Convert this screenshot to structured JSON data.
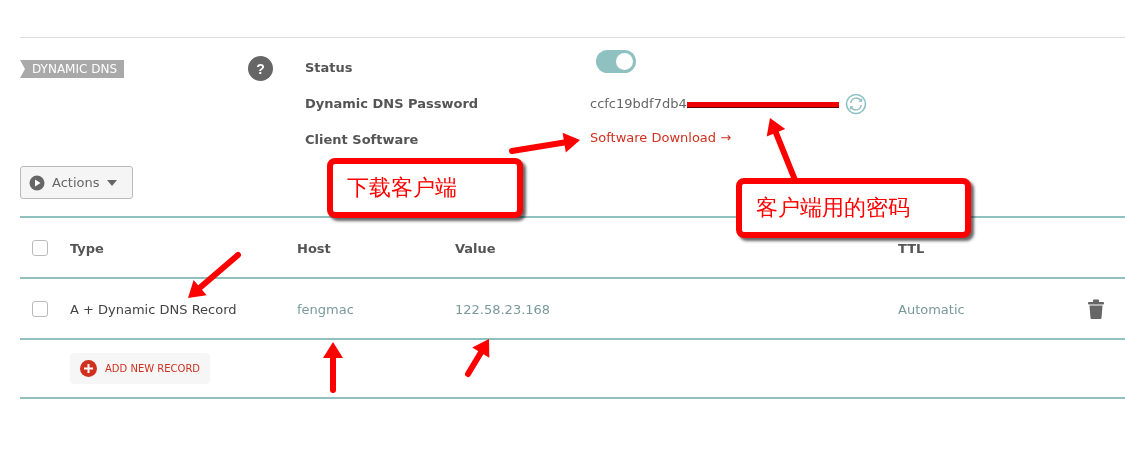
{
  "section": {
    "tag": "DYNAMIC DNS",
    "help": "?",
    "fields": [
      {
        "kind": "toggle",
        "label": "Status",
        "on": true
      },
      {
        "kind": "password",
        "label": "Dynamic DNS Password",
        "value": "ccfc19bdf7db4"
      },
      {
        "kind": "link",
        "label": "Client Software",
        "value": "Software Download →"
      }
    ]
  },
  "actions_button": {
    "label": "Actions"
  },
  "table": {
    "columns": [
      "Type",
      "Host",
      "Value",
      "TTL"
    ],
    "rows": [
      {
        "checked": false,
        "cells": [
          "A + Dynamic DNS Record",
          "fengmac",
          "122.58.23.168",
          "Automatic"
        ]
      }
    ],
    "header_checked": false,
    "add_button": "ADD NEW RECORD"
  },
  "annotations": [
    {
      "text": "下载客户端"
    },
    {
      "text": "客户端用的密码"
    }
  ]
}
